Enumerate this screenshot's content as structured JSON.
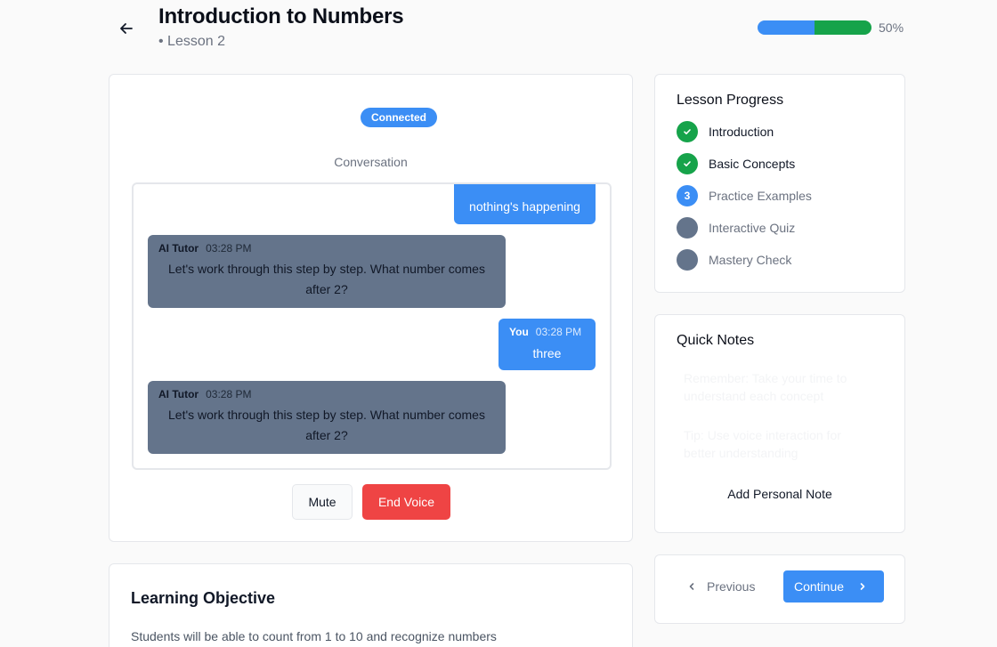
{
  "header": {
    "title": "Introduction to Numbers",
    "subtitle": "• Lesson 2",
    "progress_percent": 50,
    "progress_label": "50%",
    "progress_colors": {
      "first_half": "#3b8ef5",
      "second_half": "#16a34a"
    }
  },
  "conversation": {
    "status_badge": "Connected",
    "label": "Conversation",
    "messages": [
      {
        "role": "user",
        "sender": "",
        "time": "",
        "text": "nothing's happening"
      },
      {
        "role": "ai",
        "sender": "AI Tutor",
        "time": "03:28 PM",
        "text": "Let's work through this step by step. What number comes after 2?"
      },
      {
        "role": "user",
        "sender": "You",
        "time": "03:28 PM",
        "text": "three"
      },
      {
        "role": "ai",
        "sender": "AI Tutor",
        "time": "03:28 PM",
        "text": "Let's work through this step by step. What number comes after 2?"
      }
    ],
    "mute_label": "Mute",
    "end_voice_label": "End Voice"
  },
  "objective": {
    "title": "Learning Objective",
    "text": "Students will be able to count from 1 to 10 and recognize numbers"
  },
  "lesson_progress": {
    "title": "Lesson Progress",
    "steps": [
      {
        "label": "Introduction",
        "status": "done"
      },
      {
        "label": "Basic Concepts",
        "status": "done"
      },
      {
        "label": "Practice Examples",
        "status": "current",
        "number": "3"
      },
      {
        "label": "Interactive Quiz",
        "status": "pending"
      },
      {
        "label": "Mastery Check",
        "status": "pending"
      }
    ]
  },
  "notes": {
    "title": "Quick Notes",
    "items": [
      "Remember: Take your time to understand each concept",
      "Tip: Use voice interaction for better understanding"
    ],
    "add_label": "Add Personal Note"
  },
  "nav": {
    "previous_label": "Previous",
    "continue_label": "Continue"
  },
  "colors": {
    "accent": "#3b8ef5",
    "success": "#16a34a",
    "danger": "#ef4444",
    "ai_bubble": "#64748b",
    "pending_step": "#64748b"
  },
  "icons": {
    "back": "arrow-left-icon",
    "done": "check-icon",
    "previous": "chevron-left-icon",
    "continue": "chevron-right-icon"
  }
}
